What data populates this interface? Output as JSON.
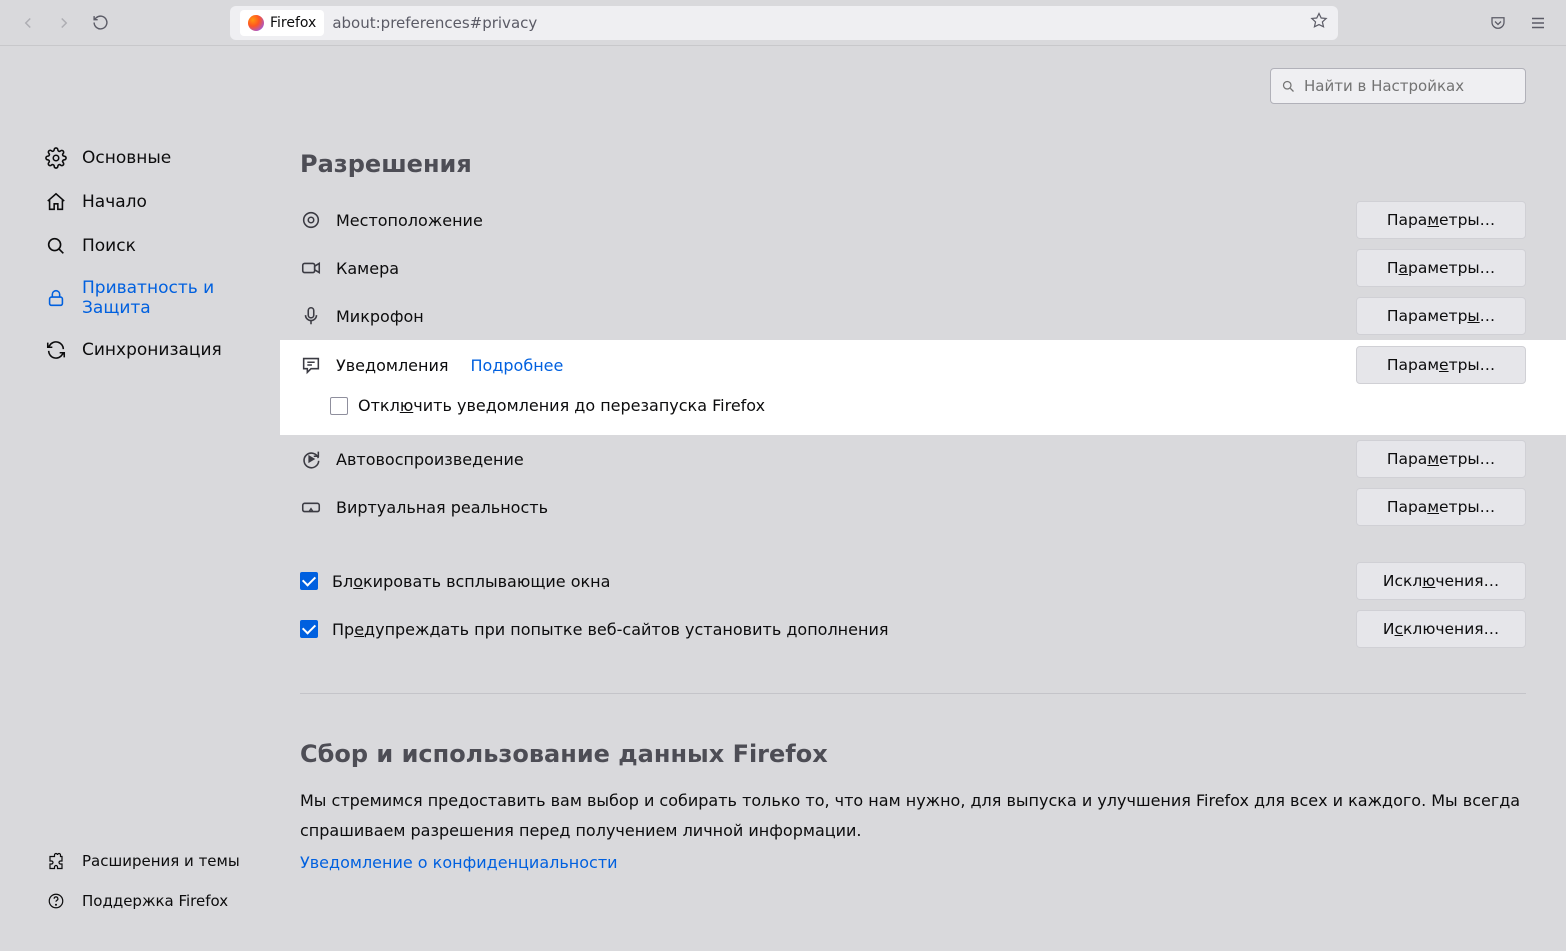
{
  "toolbar": {
    "site_label": "Firefox",
    "url": "about:preferences#privacy"
  },
  "search": {
    "placeholder": "Найти в Настройках"
  },
  "sidebar": {
    "items": [
      {
        "label": "Основные"
      },
      {
        "label": "Начало"
      },
      {
        "label": "Поиск"
      },
      {
        "label": "Приватность и Защита"
      },
      {
        "label": "Синхронизация"
      }
    ],
    "bottom": [
      {
        "label": "Расширения и темы"
      },
      {
        "label": "Поддержка Firefox"
      }
    ]
  },
  "section": {
    "heading": "Разрешения"
  },
  "perms": {
    "location": {
      "label": "Местоположение",
      "btn_pre": "Пара",
      "btn_u": "м",
      "btn_post": "етры…"
    },
    "camera": {
      "label": "Камера",
      "btn_pre": "П",
      "btn_u": "а",
      "btn_post": "раметры…"
    },
    "mic": {
      "label": "Микрофон",
      "btn_pre": "Параметр",
      "btn_u": "ы",
      "btn_post": "…"
    },
    "notif": {
      "label": "Уведомления",
      "more": "Подробнее",
      "btn_pre": "Парам",
      "btn_u": "е",
      "btn_post": "тры…",
      "disable_pre": "Откл",
      "disable_u": "ю",
      "disable_post": "чить уведомления до перезапуска Firefox"
    },
    "autoplay": {
      "label": "Автовоспроизведение",
      "btn_pre": "Пара",
      "btn_u": "м",
      "btn_post": "етры…"
    },
    "vr": {
      "label": "Виртуальная реальность",
      "btn_pre": "Пара",
      "btn_u": "м",
      "btn_post": "етры…"
    },
    "popups": {
      "pre": "Бл",
      "u": "о",
      "post": "кировать всплывающие окна",
      "btn_pre": "Искл",
      "btn_u": "ю",
      "btn_post": "чения…"
    },
    "addons": {
      "pre": "Пр",
      "u": "е",
      "post": "дупреждать при попытке веб-сайтов установить дополнения",
      "btn_pre": "И",
      "btn_u": "с",
      "btn_post": "ключения…"
    }
  },
  "data": {
    "heading": "Сбор и использование данных Firefox",
    "body": "Мы стремимся предоставить вам выбор и собирать только то, что нам нужно, для выпуска и улучшения Firefox для всех и каждого. Мы всегда спрашиваем разрешения перед получением личной информации.",
    "link": "Уведомление о конфиденциальности"
  }
}
